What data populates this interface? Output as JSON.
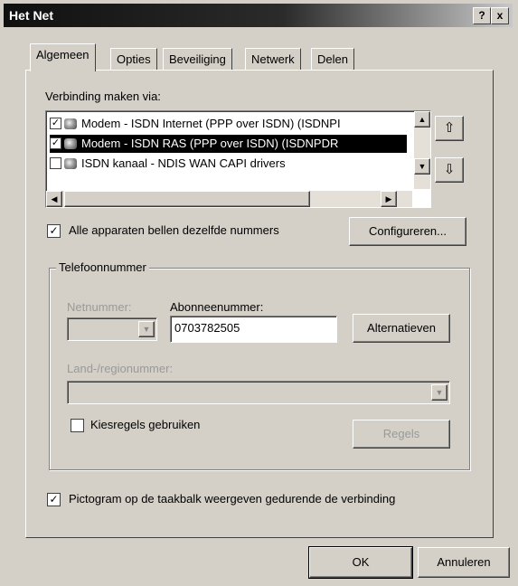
{
  "window": {
    "title": "Het Net",
    "help_btn": "?",
    "close_btn": "x"
  },
  "tabs": [
    {
      "label": "Algemeen"
    },
    {
      "label": "Opties"
    },
    {
      "label": "Beveiliging"
    },
    {
      "label": "Netwerk"
    },
    {
      "label": "Delen"
    }
  ],
  "connect_via": {
    "label": "Verbinding maken via:",
    "items": [
      {
        "text": "Modem - ISDN Internet (PPP over ISDN) (ISDNPI",
        "checked": true,
        "selected": false
      },
      {
        "text": "Modem - ISDN RAS (PPP over ISDN) (ISDNPDR",
        "checked": true,
        "selected": true
      },
      {
        "text": "ISDN  kanaal - NDIS WAN CAPI drivers",
        "checked": false,
        "selected": false
      }
    ]
  },
  "same_numbers": {
    "label": "Alle apparaten bellen dezelfde nummers",
    "checked": true
  },
  "configure_button": "Configureren...",
  "phone": {
    "group_label": "Telefoonnummer",
    "area_code_label": "Netnummer:",
    "subscriber_label": "Abonneenummer:",
    "subscriber_value": "0703782505",
    "alternatives_button": "Alternatieven",
    "country_label": "Land-/regionummer:",
    "dialing_rules_label": "Kiesregels gebruiken",
    "dialing_rules_checked": false,
    "rules_button": "Regels"
  },
  "taskbar_icon": {
    "label": "Pictogram op de taakbalk weergeven gedurende de verbinding",
    "checked": true
  },
  "ok_button": "OK",
  "cancel_button": "Annuleren"
}
